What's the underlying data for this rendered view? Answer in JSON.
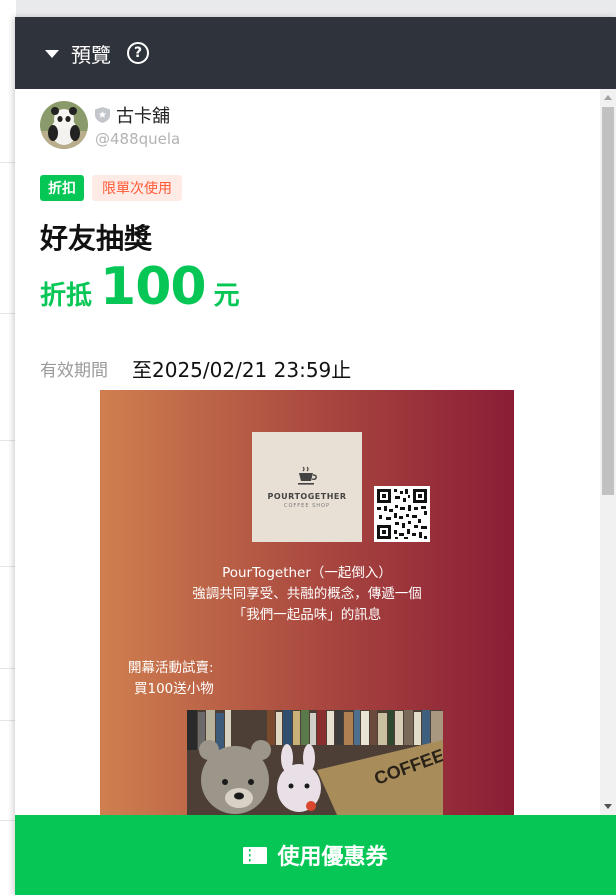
{
  "header": {
    "title": "預覽",
    "help_symbol": "?"
  },
  "shop": {
    "name": "古卡舖",
    "handle": "@488quela"
  },
  "coupon": {
    "type_tag": "折扣",
    "usage_tag": "限單次使用",
    "title": "好友抽獎",
    "discount_prefix": "折抵",
    "discount_amount": "100",
    "discount_unit": "元",
    "validity_label": "有效期間",
    "validity_value": "至2025/02/21 23:59止"
  },
  "poster": {
    "logo_name": "POURTOGETHER",
    "logo_sub": "COFFEE SHOP",
    "line1": "PourTogether（一起倒入）",
    "line2": "強調共同享受、共融的概念，傳遞一個",
    "line3": "「我們一起品味」的訊息",
    "promo1": "開幕活動試賣:",
    "promo2": "買100送小物"
  },
  "action": {
    "label": "使用優惠券"
  },
  "colors": {
    "brand_green": "#06c755",
    "topbar": "#2f333b",
    "tag_pink_text": "#ff5a36"
  },
  "icons": {
    "caret": "caret-down-icon",
    "help": "help-icon",
    "shield": "shield-icon",
    "ticket": "ticket-icon"
  }
}
